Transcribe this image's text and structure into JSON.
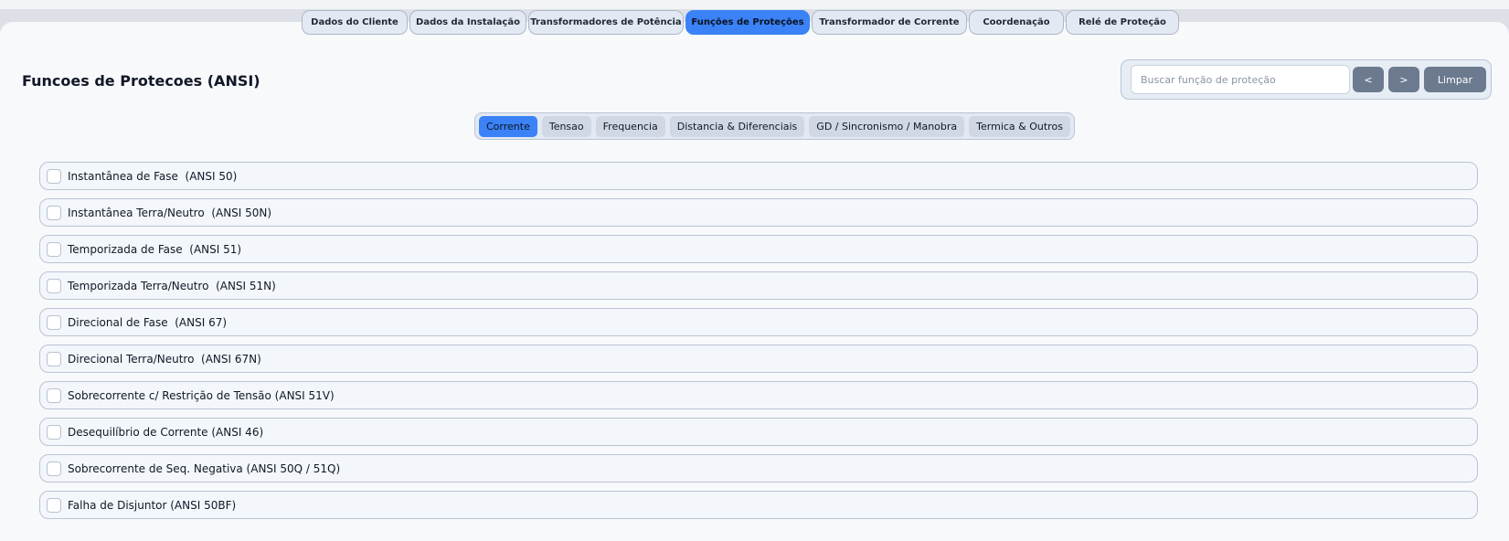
{
  "tabs": [
    {
      "label": "Dados do Cliente",
      "active": false
    },
    {
      "label": "Dados da Instalação",
      "active": false
    },
    {
      "label": "Transformadores de Potência",
      "active": false
    },
    {
      "label": "Funções de Proteções",
      "active": true
    },
    {
      "label": "Transformador de Corrente",
      "active": false
    },
    {
      "label": "Coordenação",
      "active": false
    },
    {
      "label": "Relé de Proteção",
      "active": false
    }
  ],
  "page": {
    "title": "Funcoes de Protecoes (ANSI)"
  },
  "search": {
    "placeholder": "Buscar função de proteção",
    "value": "",
    "prev_label": "<",
    "next_label": ">",
    "clear_label": "Limpar"
  },
  "categories": [
    {
      "label": "Corrente",
      "active": true
    },
    {
      "label": "Tensao",
      "active": false
    },
    {
      "label": "Frequencia",
      "active": false
    },
    {
      "label": "Distancia & Diferenciais",
      "active": false
    },
    {
      "label": "GD / Sincronismo / Manobra",
      "active": false
    },
    {
      "label": "Termica & Outros",
      "active": false
    }
  ],
  "functions": [
    {
      "label": "Instantânea de Fase  (ANSI 50)",
      "checked": false
    },
    {
      "label": "Instantânea Terra/Neutro  (ANSI 50N)",
      "checked": false
    },
    {
      "label": "Temporizada de Fase  (ANSI 51)",
      "checked": false
    },
    {
      "label": "Temporizada Terra/Neutro  (ANSI 51N)",
      "checked": false
    },
    {
      "label": "Direcional de Fase  (ANSI 67)",
      "checked": false
    },
    {
      "label": "Direcional Terra/Neutro  (ANSI 67N)",
      "checked": false
    },
    {
      "label": "Sobrecorrente c/ Restrição de Tensão (ANSI 51V)",
      "checked": false
    },
    {
      "label": "Desequilíbrio de Corrente (ANSI 46)",
      "checked": false
    },
    {
      "label": "Sobrecorrente de Seq. Negativa (ANSI 50Q / 51Q)",
      "checked": false
    },
    {
      "label": "Falha de Disjuntor (ANSI 50BF)",
      "checked": false
    }
  ],
  "colors": {
    "accent": "#3b82f6",
    "button": "#6b7a8f",
    "border": "#b9c4d4"
  }
}
